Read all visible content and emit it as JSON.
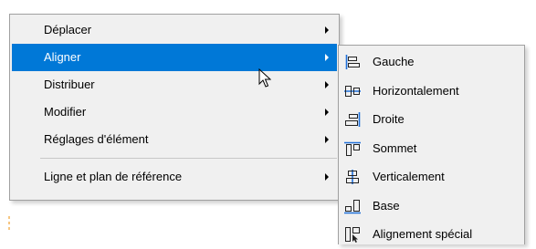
{
  "main_menu": {
    "items": [
      {
        "label": "Déplacer",
        "has_submenu": true,
        "highlighted": false
      },
      {
        "label": "Aligner",
        "has_submenu": true,
        "highlighted": true
      },
      {
        "label": "Distribuer",
        "has_submenu": true,
        "highlighted": false
      },
      {
        "label": "Modifier",
        "has_submenu": true,
        "highlighted": false
      },
      {
        "label": "Réglages d'élément",
        "has_submenu": true,
        "highlighted": false
      },
      {
        "label": "Ligne et plan de référence",
        "has_submenu": true,
        "highlighted": false
      }
    ]
  },
  "align_submenu": {
    "items": [
      {
        "label": "Gauche",
        "icon": "align-left-icon",
        "mnemonic": "G"
      },
      {
        "label": "Horizontalement",
        "icon": "align-horizontal-center-icon",
        "mnemonic": ""
      },
      {
        "label": "Droite",
        "icon": "align-right-icon",
        "mnemonic": "D"
      },
      {
        "label": "Sommet",
        "icon": "align-top-icon",
        "mnemonic": "S"
      },
      {
        "label": "Verticalement",
        "icon": "align-vertical-center-icon",
        "mnemonic": ""
      },
      {
        "label": "Base",
        "icon": "align-bottom-icon",
        "mnemonic": "B"
      },
      {
        "label": "Alignement spécial",
        "icon": "align-special-icon",
        "mnemonic": "A"
      }
    ]
  },
  "colors": {
    "menu_background": "#f0f0f0",
    "highlight": "#0078d7",
    "icon_accent": "#1e6fd9",
    "marker": "#f0a030"
  }
}
